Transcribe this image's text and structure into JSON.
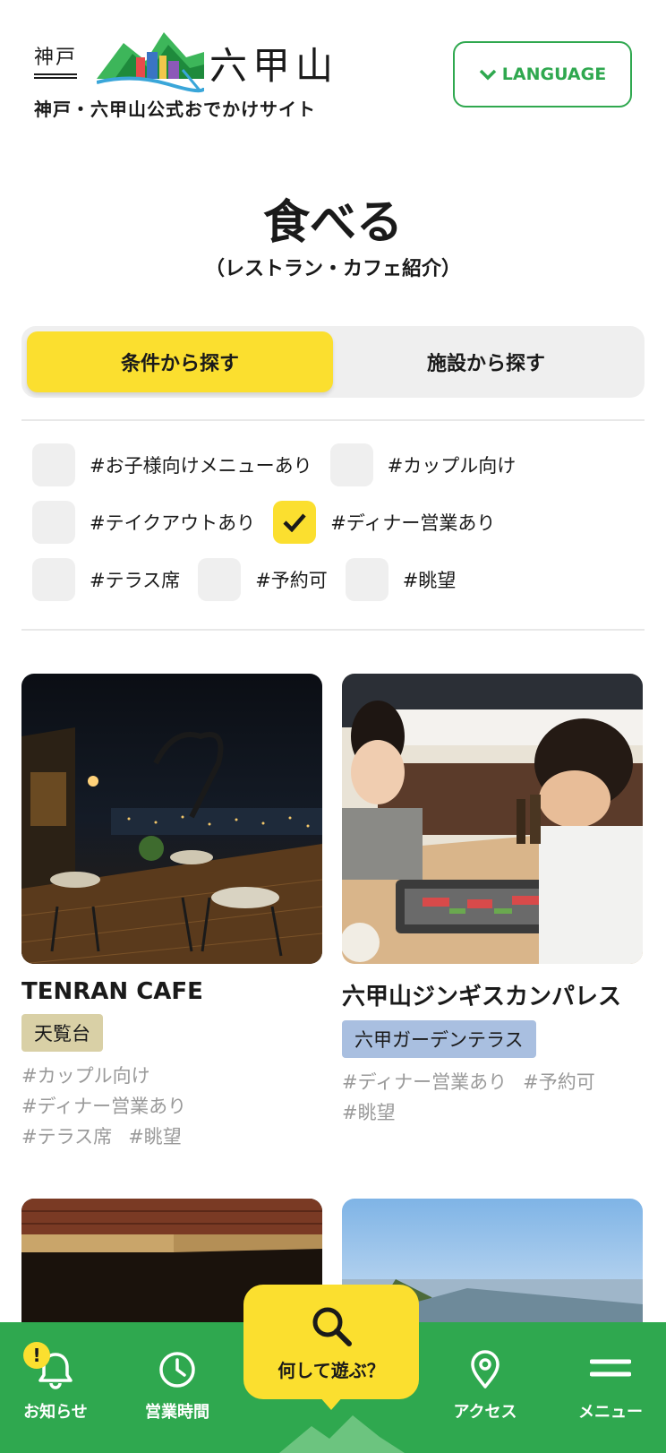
{
  "header": {
    "logo_kobe": "神戸",
    "logo_rokko": "六甲山",
    "logo_sub": "神戸・六甲山公式おでかけサイト",
    "language_label": "LANGUAGE"
  },
  "page": {
    "title": "食べる",
    "subtitle": "（レストラン・カフェ紹介）"
  },
  "tabs": [
    {
      "label": "条件から探す",
      "active": true
    },
    {
      "label": "施設から探す",
      "active": false
    }
  ],
  "filters": [
    [
      {
        "label": "#お子様向けメニューあり",
        "checked": false
      },
      {
        "label": "#カップル向け",
        "checked": false
      }
    ],
    [
      {
        "label": "#テイクアウトあり",
        "checked": false
      },
      {
        "label": "#ディナー営業あり",
        "checked": true
      }
    ],
    [
      {
        "label": "#テラス席",
        "checked": false
      },
      {
        "label": "#予約可",
        "checked": false
      },
      {
        "label": "#眺望",
        "checked": false
      }
    ]
  ],
  "cards": [
    {
      "name": "TENRAN CAFE",
      "area": "天覧台",
      "area_color": "#d9d0a6",
      "tags": [
        "#カップル向け",
        "#ディナー営業あり",
        "#テラス席",
        "#眺望"
      ]
    },
    {
      "name": "六甲山ジンギスカンパレス",
      "area": "六甲ガーデンテラス",
      "area_color": "#a9bfe0",
      "tags": [
        "#ディナー営業あり",
        "#予約可",
        "#眺望"
      ]
    }
  ],
  "nav": {
    "notice": "お知らせ",
    "hours": "営業時間",
    "center": "何して遊ぶ？",
    "access": "アクセス",
    "menu": "メニュー",
    "notice_badge": "!"
  },
  "colors": {
    "accent_green": "#2fa84f",
    "accent_yellow": "#fbdf2f"
  }
}
